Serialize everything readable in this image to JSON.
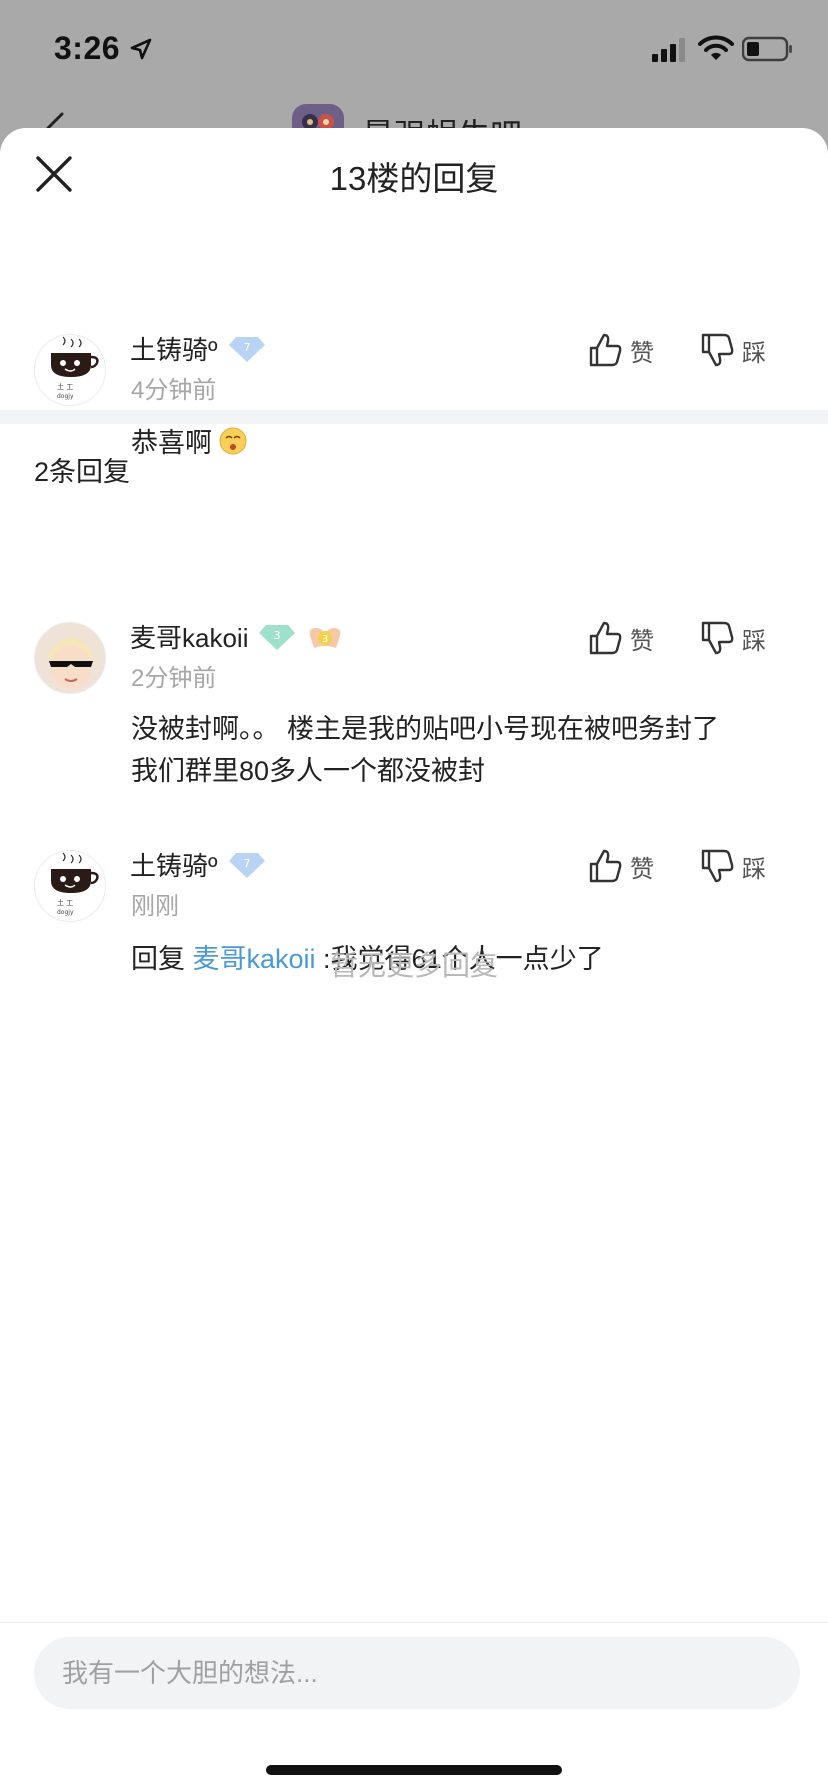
{
  "status_bar": {
    "time": "3:26"
  },
  "background_page": {
    "title": "最强蜗牛吧"
  },
  "sheet": {
    "title": "13楼的回复",
    "main_post": {
      "username": "土铸骑º",
      "level_badge": "7",
      "time": "4分钟前",
      "content": "恭喜啊",
      "like_label": "赞",
      "dislike_label": "踩"
    },
    "reply_count_label": "2条回复",
    "replies": [
      {
        "username": "麦哥kakoii",
        "level_badge": "3",
        "extra_badge": "3",
        "time": "2分钟前",
        "content_line1": "没被封啊。。 楼主是我的贴吧小号现在被吧务封了",
        "content_line2": "我们群里80多人一个都没被封",
        "like_label": "赞",
        "dislike_label": "踩"
      },
      {
        "username": "土铸骑º",
        "level_badge": "7",
        "time": "刚刚",
        "reply_prefix": "回复 ",
        "reply_target": "麦哥kakoii",
        "content": " :我觉得61个人一点少了",
        "like_label": "赞",
        "dislike_label": "踩"
      }
    ],
    "no_more_label": "暂无更多回复"
  },
  "comment_input": {
    "placeholder": "我有一个大胆的想法..."
  },
  "colors": {
    "link": "#4a9ad4",
    "overlay": "#a9a9aa",
    "badge_blue": "#b9d3f5",
    "badge_green": "#9ee0cc"
  }
}
